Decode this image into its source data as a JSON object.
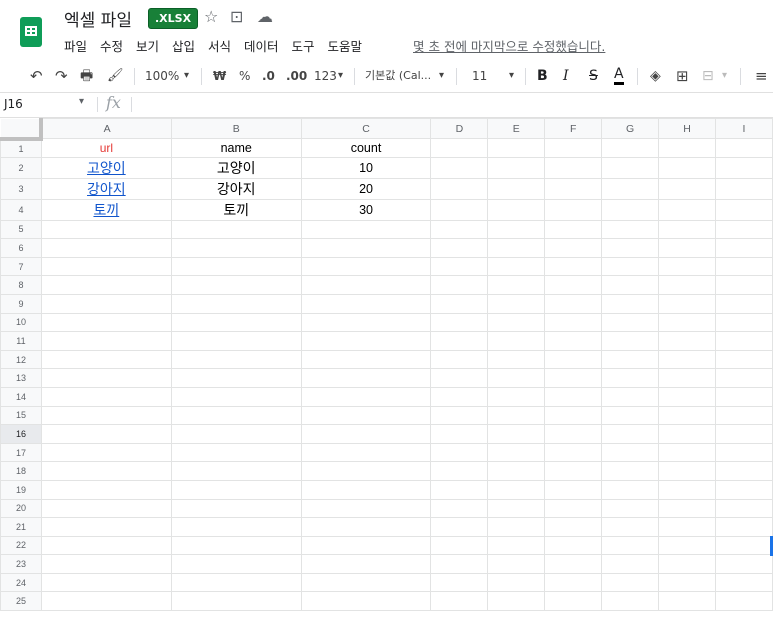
{
  "header": {
    "title": "엑셀 파일",
    "badge": ".XLSX",
    "star_icon": "☆",
    "move_icon": "⊡",
    "cloud_icon": "☁",
    "menu": [
      "파일",
      "수정",
      "보기",
      "삽입",
      "서식",
      "데이터",
      "도구",
      "도움말"
    ],
    "last_edit": "몇 초 전에 마지막으로 수정했습니다."
  },
  "toolbar": {
    "undo": "↶",
    "redo": "↷",
    "print": "🖶",
    "paint_format": "🖌",
    "zoom": "100%",
    "currency": "₩",
    "percent": "%",
    "dec_decrease": ".0",
    "dec_increase": ".00",
    "format_more": "123",
    "font": "기본값 (Cal...",
    "font_size": "11",
    "bold": "B",
    "italic": "I",
    "strike": "S",
    "text_color": "A",
    "fill": "◈",
    "borders": "⊞",
    "merge": "⊟",
    "align": "≡",
    "dropdown": "▾"
  },
  "formula_bar": {
    "name_box": "J16",
    "fx": "fx",
    "value": ""
  },
  "sheet": {
    "columns": [
      "A",
      "B",
      "C",
      "D",
      "E",
      "F",
      "G",
      "H",
      "I"
    ],
    "rows": [
      {
        "n": "1",
        "a": "url",
        "b": "name",
        "c": "count"
      },
      {
        "n": "2",
        "a": "고양이",
        "b": "고양이",
        "c": "10"
      },
      {
        "n": "3",
        "a": "강아지",
        "b": "강아지",
        "c": "20"
      },
      {
        "n": "4",
        "a": "토끼",
        "b": "토끼",
        "c": "30"
      },
      {
        "n": "5"
      },
      {
        "n": "6"
      },
      {
        "n": "7"
      },
      {
        "n": "8"
      },
      {
        "n": "9"
      },
      {
        "n": "10"
      },
      {
        "n": "11"
      },
      {
        "n": "12"
      },
      {
        "n": "13"
      },
      {
        "n": "14"
      },
      {
        "n": "15"
      },
      {
        "n": "16"
      },
      {
        "n": "17"
      },
      {
        "n": "18"
      },
      {
        "n": "19"
      },
      {
        "n": "20"
      },
      {
        "n": "21"
      },
      {
        "n": "22"
      },
      {
        "n": "23"
      },
      {
        "n": "24"
      },
      {
        "n": "25"
      }
    ]
  },
  "colors": {
    "accent": "#0f9d58",
    "link": "#1155cc",
    "header_red": "#e53935"
  }
}
